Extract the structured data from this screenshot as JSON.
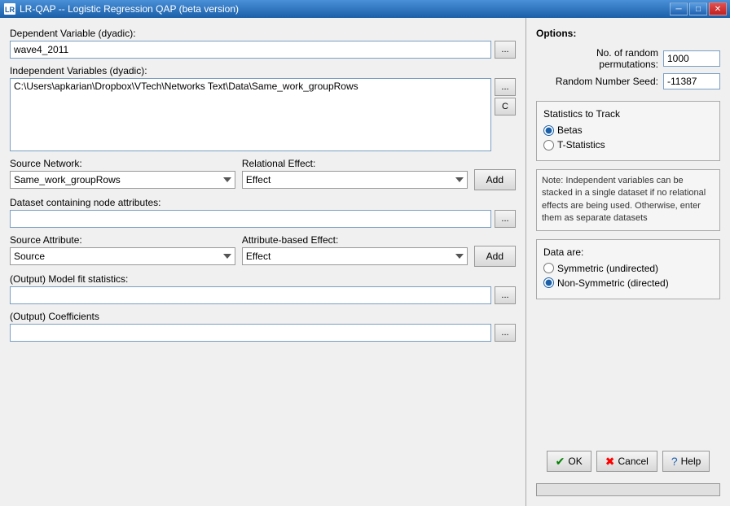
{
  "titleBar": {
    "icon": "LR",
    "title": "LR-QAP -- Logistic Regression QAP (beta version)",
    "minimizeLabel": "─",
    "maximizeLabel": "□",
    "closeLabel": "✕"
  },
  "left": {
    "dependentVariable": {
      "label": "Dependent Variable (dyadic):",
      "value": "wave4_2011",
      "browseLabel": "..."
    },
    "independentVariables": {
      "label": "Independent Variables (dyadic):",
      "value": "C:\\Users\\apkarian\\Dropbox\\VTech\\Networks Text\\Data\\Same_work_groupRows",
      "browsLabel": "...",
      "clearLabel": "C"
    },
    "sourceNetwork": {
      "label": "Source Network:",
      "options": [
        "Same_work_groupRows"
      ],
      "selected": "Same_work_groupRows"
    },
    "relationalEffect": {
      "label": "Relational Effect:",
      "options": [
        "Effect"
      ],
      "selected": "Effect"
    },
    "addButton1": "Add",
    "datasetLabel": "Dataset containing node attributes:",
    "datasetValue": "",
    "datasetBrowse": "...",
    "sourceAttribute": {
      "label": "Source Attribute:",
      "options": [
        "Source"
      ],
      "selected": "Source"
    },
    "attributeBasedEffect": {
      "label": "Attribute-based Effect:",
      "options": [
        "Effect"
      ],
      "selected": "Effect"
    },
    "addButton2": "Add",
    "outputModelFit": {
      "label": "(Output) Model fit statistics:",
      "value": "",
      "browseLabel": "..."
    },
    "outputCoefficients": {
      "label": "(Output) Coefficients",
      "value": "",
      "browseLabel": "..."
    }
  },
  "right": {
    "optionsLabel": "Options:",
    "noRandomPermutations": {
      "label": "No. of random permutations:",
      "value": "1000"
    },
    "randomNumberSeed": {
      "label": "Random Number Seed:",
      "value": "-11387"
    },
    "statisticsToTrack": {
      "label": "Statistics to Track",
      "options": [
        {
          "label": "Betas",
          "checked": true
        },
        {
          "label": "T-Statistics",
          "checked": false
        }
      ]
    },
    "note": "Note: Independent variables can be stacked in a single dataset if no relational effects are being used. Otherwise, enter them as separate datasets",
    "dataAre": {
      "label": "Data are:",
      "options": [
        {
          "label": "Symmetric (undirected)",
          "checked": false
        },
        {
          "label": "Non-Symmetric (directed)",
          "checked": true
        }
      ]
    },
    "okButton": "OK",
    "cancelButton": "Cancel",
    "helpButton": "Help"
  }
}
